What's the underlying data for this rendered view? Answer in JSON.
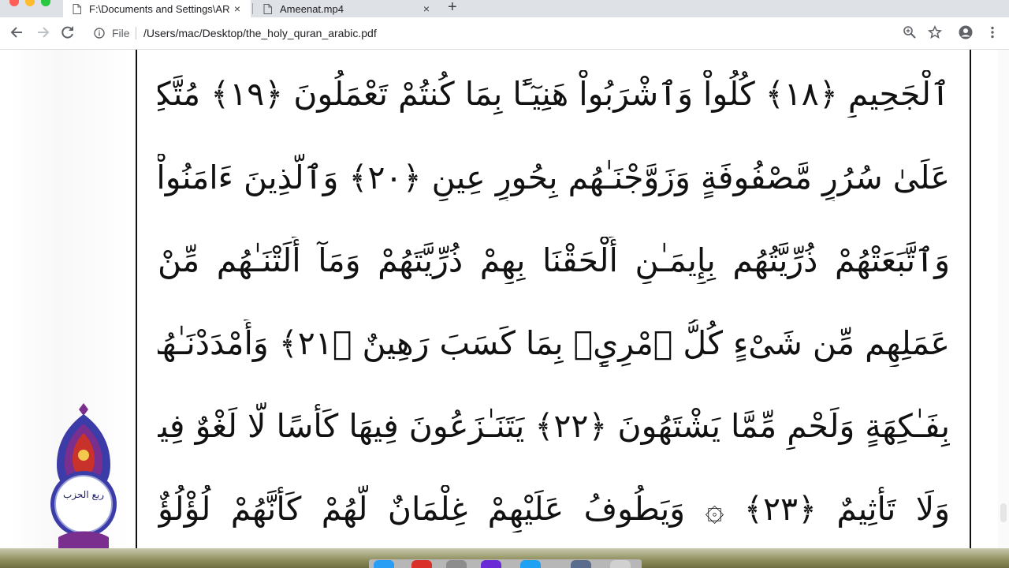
{
  "browser": {
    "tabs": [
      {
        "title": "F:\\Documents and Settings\\AR",
        "close_icon": "×",
        "active": true
      },
      {
        "title": "Ameenat.mp4",
        "close_icon": "×",
        "active": false
      }
    ],
    "new_tab_icon": "+",
    "address_bar": {
      "scheme_label": "File",
      "url": "/Users/mac/Desktop/the_holy_quran_arabic.pdf"
    },
    "icons": [
      "back-arrow-icon",
      "forward-arrow-icon",
      "reload-icon",
      "info-icon",
      "zoom-icon",
      "star-icon",
      "account-icon",
      "menu-icon"
    ]
  },
  "document": {
    "lines": [
      "ٱلْجَحِيمِ ﴿١٨﴾ كُلُواْ وَٱشْرَبُواْ هَنِيٓـًٔا بِمَا كُنتُمْ تَعْمَلُونَ ﴿١٩﴾ مُتَّكِـِٔينَ",
      "عَلَىٰ سُرُرٍ مَّصْفُوفَةٍ وَزَوَّجْنَـٰهُم بِحُورٍ عِينٍ ﴿٢٠﴾ وَٱلَّذِينَ ءَامَنُواْ",
      "وَٱتَّبَعَتْهُمْ ذُرِّيَّتُهُم بِإِيمَـٰنٍ أَلْحَقْنَا بِهِمْ ذُرِّيَّتَهُمْ وَمَآ أَلَتْنَـٰهُم مِّنْ",
      "عَمَلِهِم مِّن شَىْءٍ كُلُّ ٱمْرِىٍٕۭ بِمَا كَسَبَ رَهِينٌ ﴿٢١﴾ وَأَمْدَدْنَـٰهُم",
      "بِفَـٰكِهَةٍ وَلَحْمٍ مِّمَّا يَشْتَهُونَ ﴿٢٢﴾ يَتَنَـٰزَعُونَ فِيهَا كَأْسًا لَّا لَغْوٌ فِيهَا",
      "وَلَا تَأْثِيمٌ ﴿٢٣﴾ ۞ وَيَطُوفُ عَلَيْهِمْ غِلْمَانٌ لَّهُمْ كَأَنَّهُمْ لُؤْلُؤٌ"
    ],
    "margin_marker": "ربع الحزب"
  },
  "colors": {
    "tab_strip": "#dee1e6",
    "text": "#111111",
    "ornament_blue": "#3c3ca8",
    "ornament_purple": "#7a2e8e",
    "ornament_red": "#c8322b"
  }
}
